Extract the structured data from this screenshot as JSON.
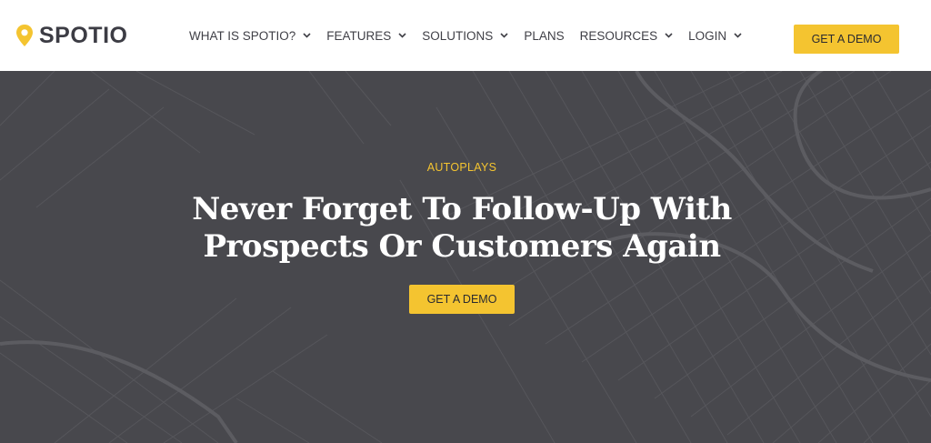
{
  "brand": {
    "name": "SPOTIO",
    "accent": "#f4c430",
    "pin_icon": "map-pin-icon"
  },
  "nav": {
    "items": [
      {
        "label": "WHAT IS SPOTIO?",
        "has_dropdown": true
      },
      {
        "label": "FEATURES",
        "has_dropdown": true
      },
      {
        "label": "SOLUTIONS",
        "has_dropdown": true
      },
      {
        "label": "PLANS",
        "has_dropdown": false
      },
      {
        "label": "RESOURCES",
        "has_dropdown": true
      },
      {
        "label": "LOGIN",
        "has_dropdown": true
      }
    ],
    "cta_label": "GET A DEMO"
  },
  "hero": {
    "eyebrow": "AUTOPLAYS",
    "headline_line1": "Never Forget To Follow-Up With",
    "headline_line2": "Prospects Or Customers Again",
    "cta_label": "GET A DEMO",
    "background": "#48484d"
  }
}
